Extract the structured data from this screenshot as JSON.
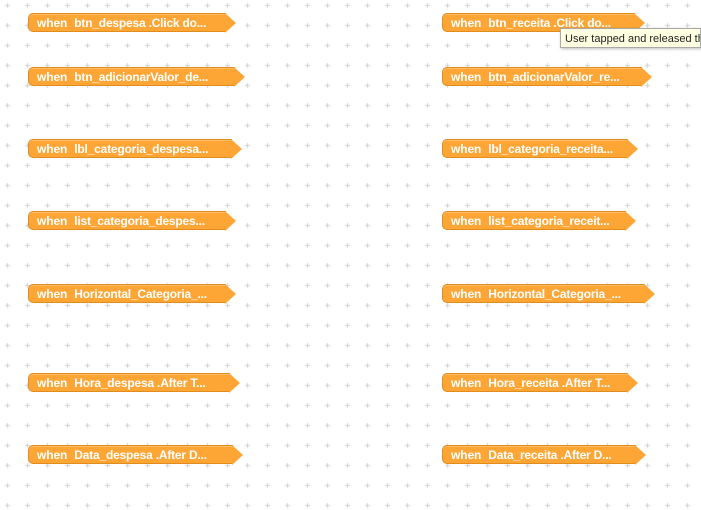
{
  "blocks": [
    {
      "keyword": "when",
      "label": "btn_despesa .Click do..."
    },
    {
      "keyword": "when",
      "label": "btn_receita .Click do..."
    },
    {
      "keyword": "when",
      "label": "btn_adicionarValor_de..."
    },
    {
      "keyword": "when",
      "label": "btn_adicionarValor_re..."
    },
    {
      "keyword": "when",
      "label": "lbl_categoria_despesa..."
    },
    {
      "keyword": "when",
      "label": "lbl_categoria_receita..."
    },
    {
      "keyword": "when",
      "label": "list_categoria_despes..."
    },
    {
      "keyword": "when",
      "label": "list_categoria_receit..."
    },
    {
      "keyword": "when",
      "label": "Horizontal_Categoria_..."
    },
    {
      "keyword": "when",
      "label": "Horizontal_Categoria_..."
    },
    {
      "keyword": "when",
      "label": "Hora_despesa .After T..."
    },
    {
      "keyword": "when",
      "label": "Hora_receita .After T..."
    },
    {
      "keyword": "when",
      "label": "Data_despesa .After D..."
    },
    {
      "keyword": "when",
      "label": "Data_receita .After D..."
    }
  ],
  "tooltip": {
    "text": "User tapped and released the button."
  },
  "colors": {
    "event_block": "#fda635",
    "tooltip_bg": "#ffffe1"
  }
}
